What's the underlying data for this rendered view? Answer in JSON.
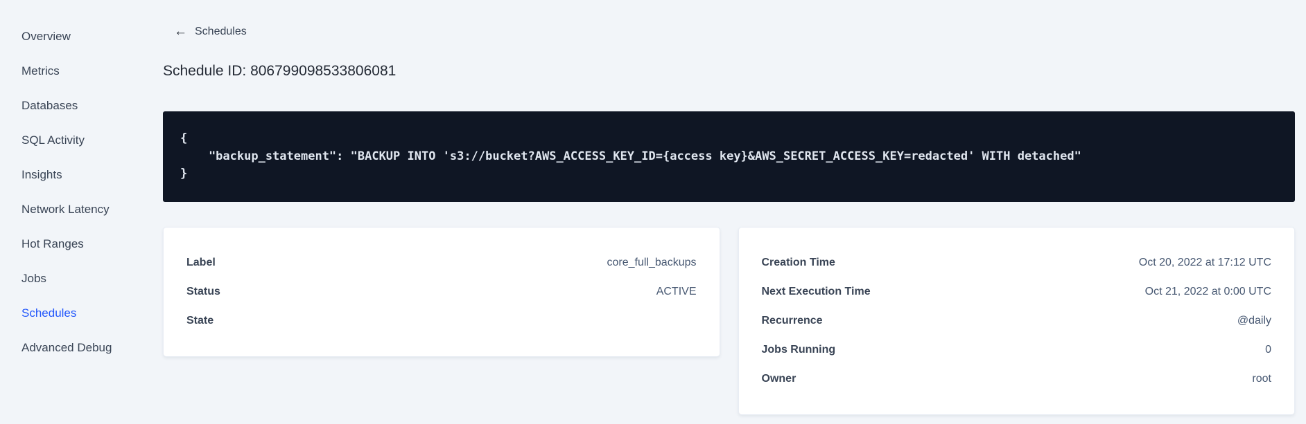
{
  "sidebar": {
    "items": [
      {
        "label": "Overview",
        "active": false
      },
      {
        "label": "Metrics",
        "active": false
      },
      {
        "label": "Databases",
        "active": false
      },
      {
        "label": "SQL Activity",
        "active": false
      },
      {
        "label": "Insights",
        "active": false
      },
      {
        "label": "Network Latency",
        "active": false
      },
      {
        "label": "Hot Ranges",
        "active": false
      },
      {
        "label": "Jobs",
        "active": false
      },
      {
        "label": "Schedules",
        "active": true
      },
      {
        "label": "Advanced Debug",
        "active": false
      }
    ]
  },
  "header": {
    "back_icon": "left-arrow",
    "back_arrow_glyph": "←",
    "back_label": "Schedules",
    "title": "Schedule ID: 806799098533806081"
  },
  "code_block": {
    "lines": [
      "{",
      "    \"backup_statement\": \"BACKUP INTO 's3://bucket?AWS_ACCESS_KEY_ID={access key}&AWS_SECRET_ACCESS_KEY=redacted' WITH detached\"",
      "}"
    ]
  },
  "cards": {
    "left": {
      "rows": [
        {
          "label": "Label",
          "value": "core_full_backups"
        },
        {
          "label": "Status",
          "value": "ACTIVE"
        },
        {
          "label": "State",
          "value": ""
        }
      ]
    },
    "right": {
      "rows": [
        {
          "label": "Creation Time",
          "value": "Oct 20, 2022 at 17:12 UTC"
        },
        {
          "label": "Next Execution Time",
          "value": "Oct 21, 2022 at 0:00 UTC"
        },
        {
          "label": "Recurrence",
          "value": "@daily"
        },
        {
          "label": "Jobs Running",
          "value": "0"
        },
        {
          "label": "Owner",
          "value": "root"
        }
      ]
    }
  },
  "colors": {
    "page_background": "#F2F5F9",
    "accent_blue": "#2458FB",
    "text_dark": "#394455",
    "code_background": "#0F1624",
    "code_text": "#E0E6EF"
  }
}
